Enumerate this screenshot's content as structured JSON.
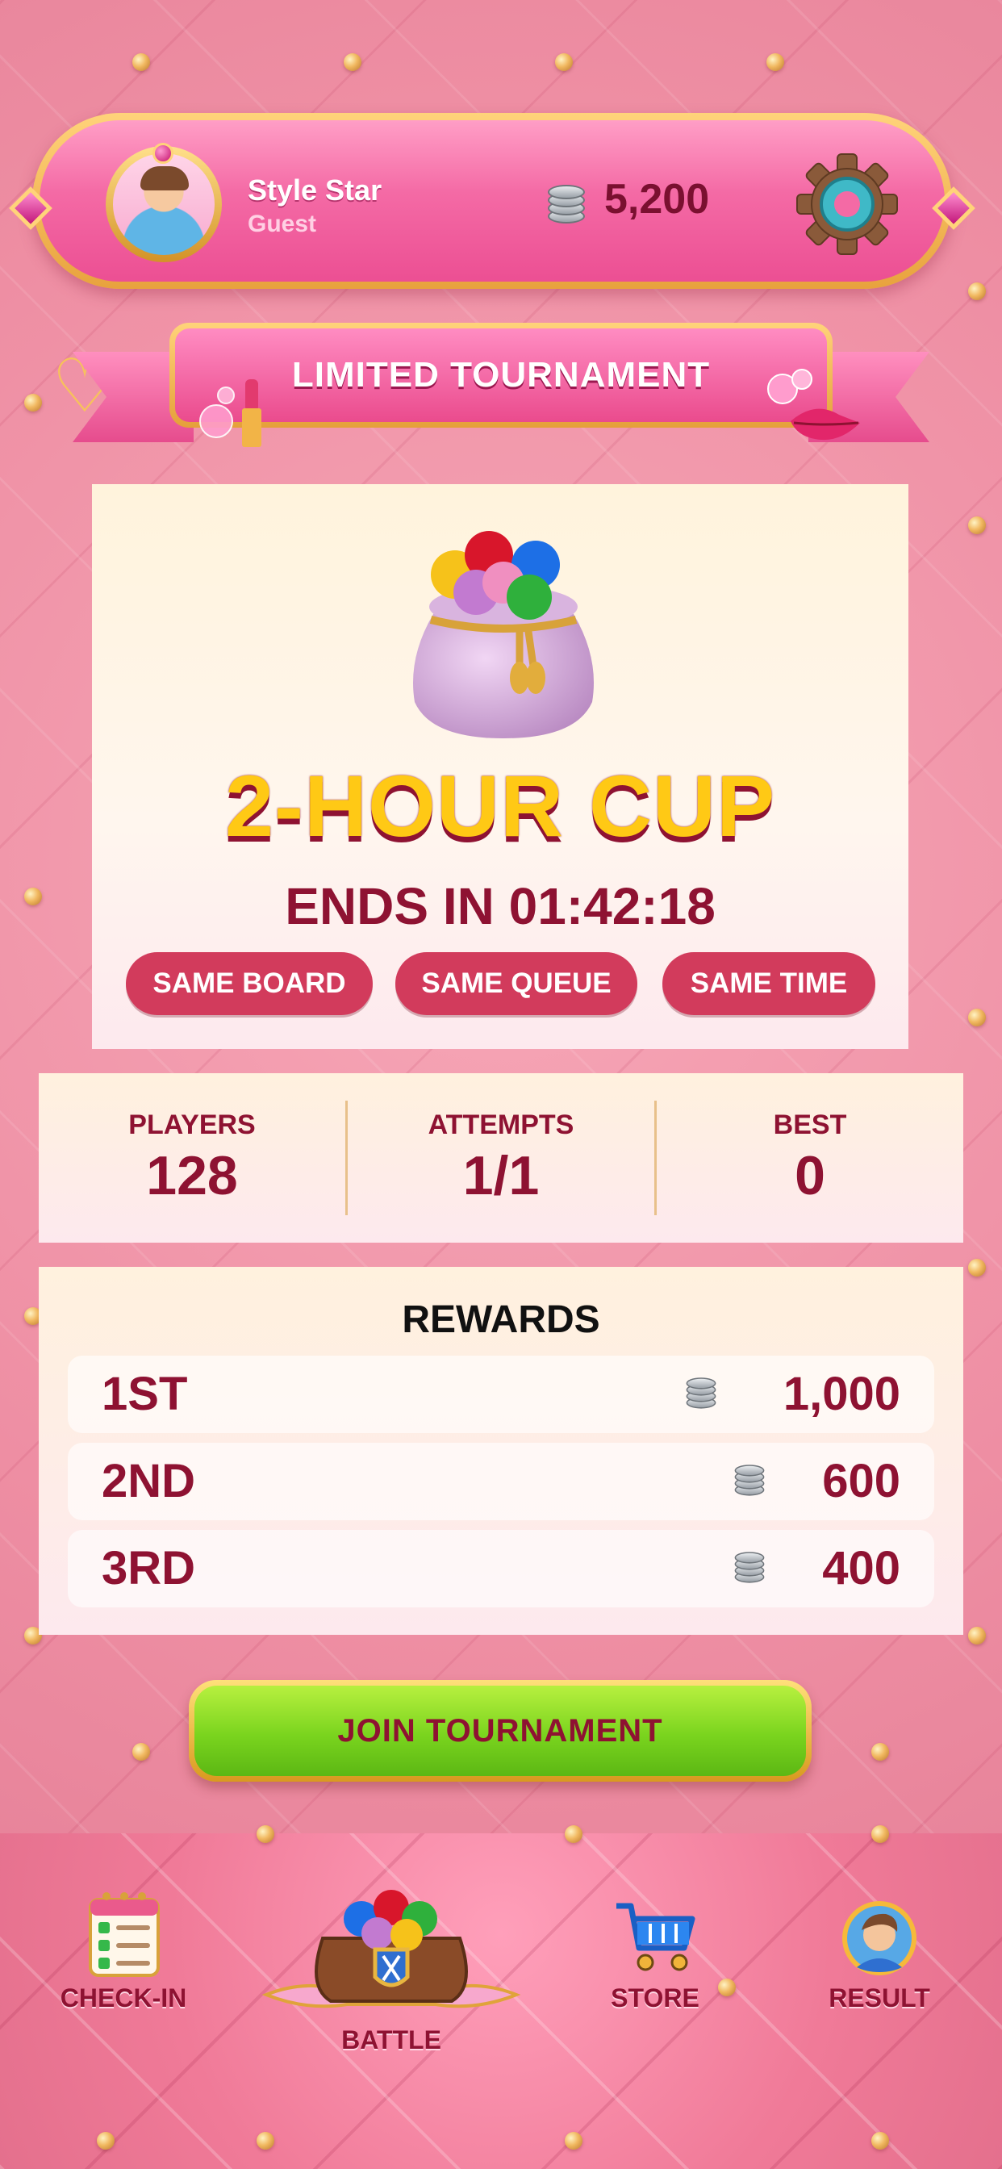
{
  "profile": {
    "name": "Style Star",
    "status": "Guest",
    "avatar_icon": "boy-avatar-icon"
  },
  "currency": {
    "balance": "5,200",
    "icon": "silver-coin-stack-icon"
  },
  "header": {
    "settings_icon": "gear-icon"
  },
  "banner": {
    "title": "LIMITED TOURNAMENT"
  },
  "tournament": {
    "prize_icon": "gumball-bag-icon",
    "title": "2-HOUR CUP",
    "countdown": "ENDS IN 01:42:18",
    "tags": [
      "SAME BOARD",
      "SAME QUEUE",
      "SAME TIME"
    ]
  },
  "stats": [
    {
      "label": "PLAYERS",
      "value": "128"
    },
    {
      "label": "ATTEMPTS",
      "value": "1/1"
    },
    {
      "label": "BEST",
      "value": "0"
    }
  ],
  "rewards": {
    "title": "REWARDS",
    "rows": [
      {
        "rank": "1ST",
        "amount": "1,000"
      },
      {
        "rank": "2ND",
        "amount": "600"
      },
      {
        "rank": "3RD",
        "amount": "400"
      }
    ]
  },
  "join_button": {
    "label": "JOIN TOURNAMENT"
  },
  "nav": [
    {
      "label": "CHECK-IN",
      "icon": "checklist-icon"
    },
    {
      "label": "BATTLE",
      "icon": "battle-bag-icon",
      "active": true
    },
    {
      "label": "STORE",
      "icon": "shopping-cart-icon"
    },
    {
      "label": "RESULT",
      "icon": "avatar-result-icon"
    }
  ],
  "colors": {
    "primary_text": "#8e1232",
    "cup_title": "#ffc915",
    "pill": "#d23b5c",
    "join_button": "#7ad41e",
    "frame_gold": "#e8a23d",
    "header_pink": "#f46aa5"
  }
}
